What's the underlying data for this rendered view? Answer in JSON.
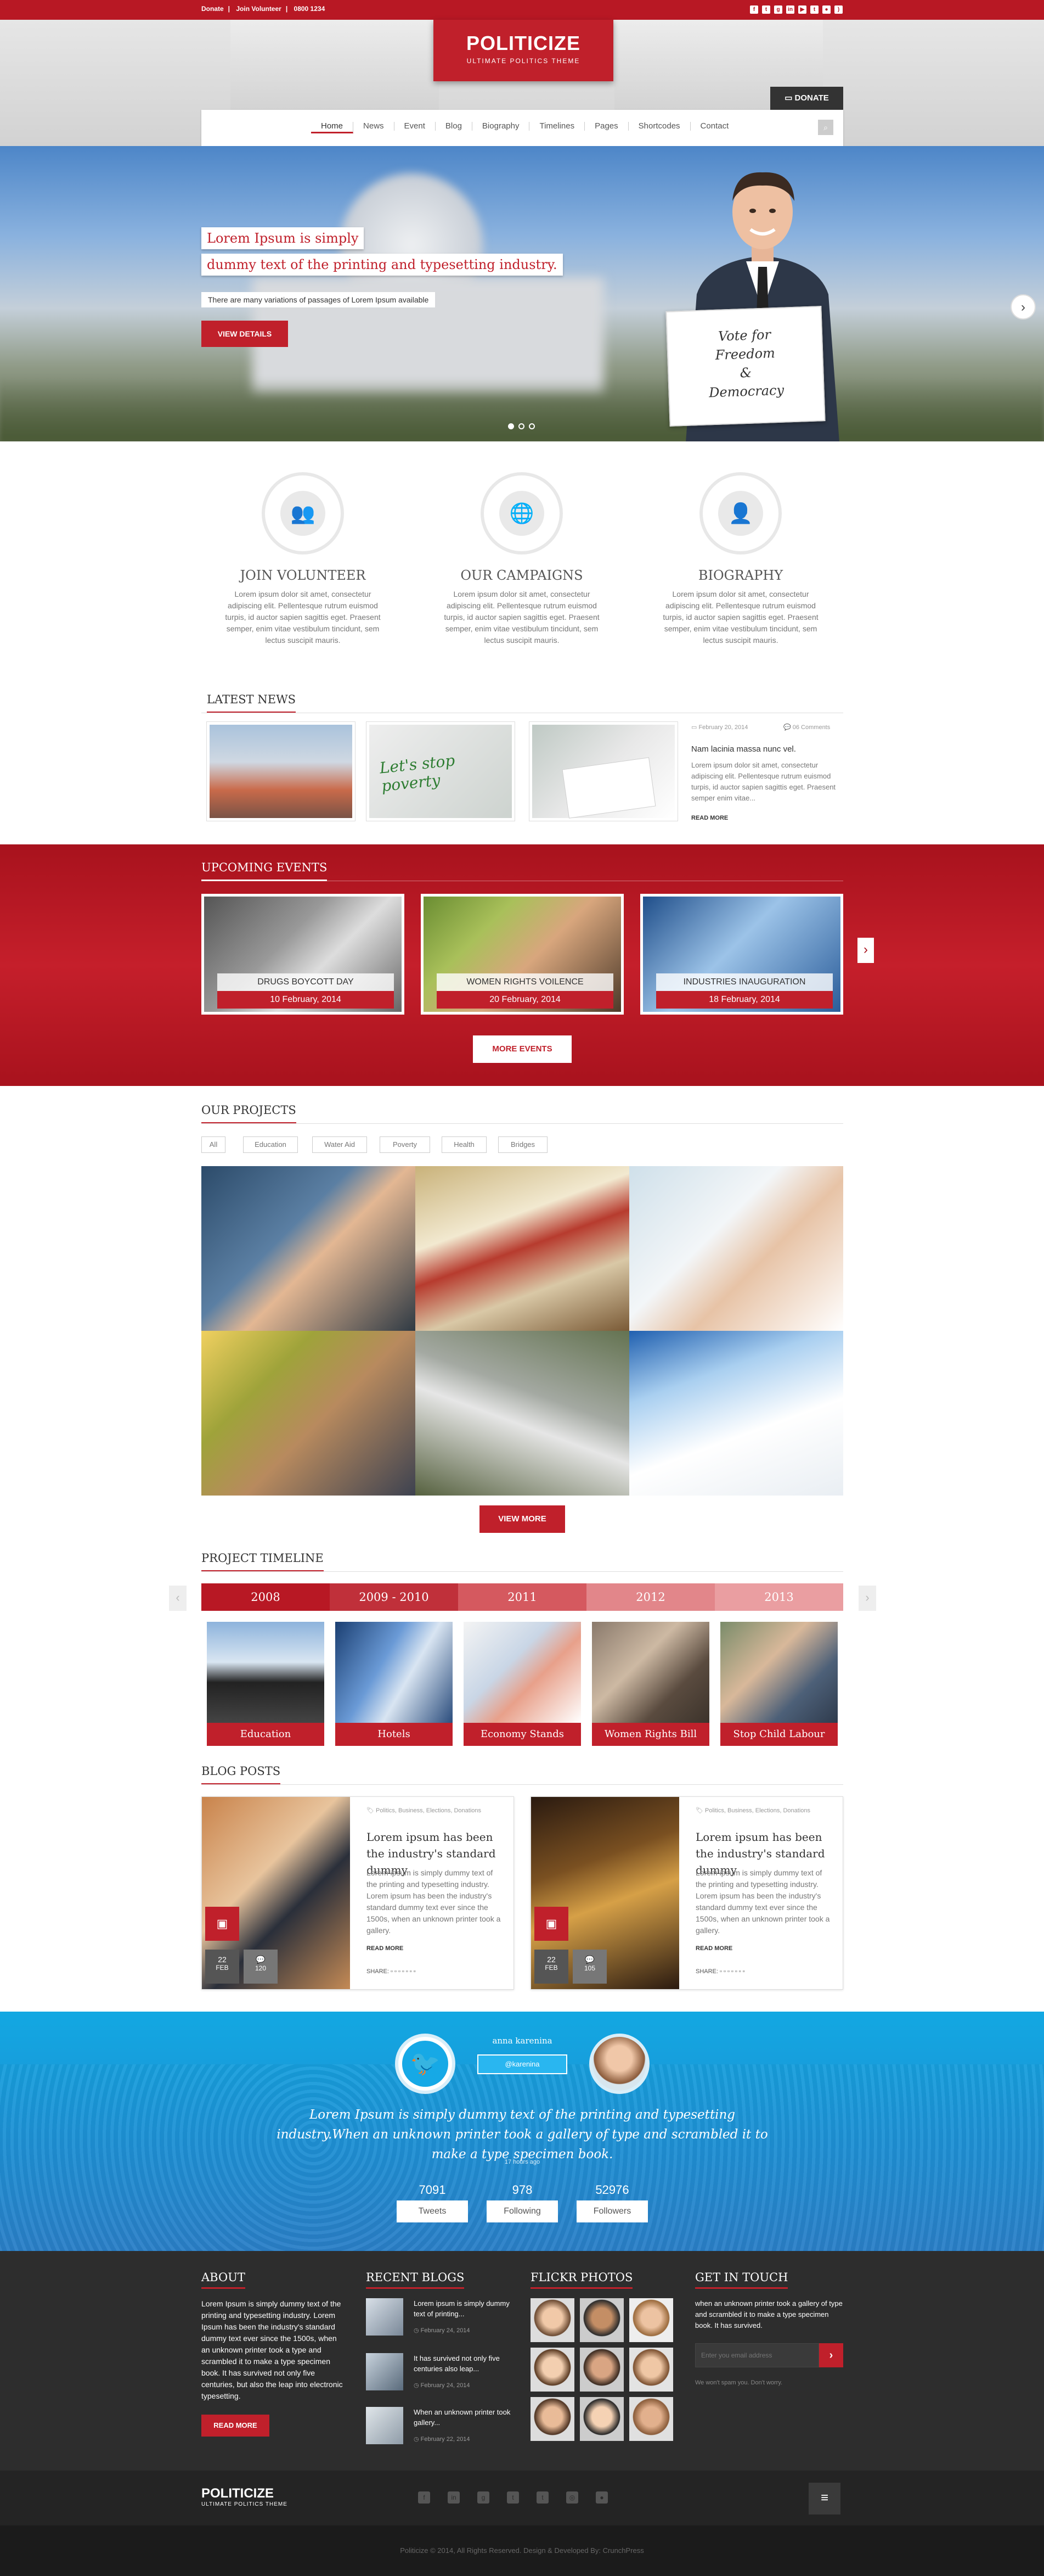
{
  "topbar": {
    "donate": "Donate",
    "volunteer": "Join Volunteer",
    "phone": "0800 1234",
    "social_icons": [
      "facebook-icon",
      "twitter-icon",
      "google-plus-icon",
      "linkedin-icon",
      "youtube-icon",
      "tumblr-icon",
      "flickr-icon",
      "rss-icon"
    ]
  },
  "logo": {
    "title": "POLITICIZE",
    "subtitle": "ULTIMATE POLITICS THEME"
  },
  "donate_button": "DONATE",
  "nav": [
    "Home",
    "News",
    "Event",
    "Blog",
    "Biography",
    "Timelines",
    "Pages",
    "Shortcodes",
    "Contact"
  ],
  "hero": {
    "headline1": "Lorem Ipsum is simply",
    "headline2": "dummy text of the printing and typesetting industry.",
    "sub": "There are many variations of passages of Lorem Ipsum available",
    "button": "VIEW DETAILS",
    "sign": [
      "Vote for",
      "Freedom",
      "&",
      "Democracy"
    ]
  },
  "features": [
    {
      "title": "JOIN VOLUNTEER",
      "text": "Lorem ipsum dolor sit amet, consectetur adipiscing elit. Pellentesque rutrum euismod turpis, id auctor sapien sagittis eget. Praesent semper, enim vitae vestibulum tincidunt, sem lectus suscipit mauris."
    },
    {
      "title": "OUR CAMPAIGNS",
      "text": "Lorem ipsum dolor sit amet, consectetur adipiscing elit. Pellentesque rutrum euismod turpis, id auctor sapien sagittis eget. Praesent semper, enim vitae vestibulum tincidunt, sem lectus suscipit mauris."
    },
    {
      "title": "BIOGRAPHY",
      "text": "Lorem ipsum dolor sit amet, consectetur adipiscing elit. Pellentesque rutrum euismod turpis, id auctor sapien sagittis eget. Praesent semper, enim vitae vestibulum tincidunt, sem lectus suscipit mauris."
    }
  ],
  "news": {
    "heading": "LATEST NEWS",
    "date": "February 20, 2014",
    "comments": "06 Comments",
    "title": "Nam lacinia massa nunc vel.",
    "text": "Lorem ipsum dolor sit amet, consectetur adipiscing elit. Pellentesque rutrum euismod turpis, id auctor sapien sagittis eget. Praesent semper enim vitae...",
    "readmore": "READ MORE",
    "img2_text": "Let's stop poverty"
  },
  "events": {
    "heading": "UPCOMING EVENTS",
    "items": [
      {
        "title": "DRUGS BOYCOTT DAY",
        "date": "10 February, 2014"
      },
      {
        "title": "WOMEN RIGHTS VOILENCE",
        "date": "20 February, 2014"
      },
      {
        "title": "INDUSTRIES INAUGURATION",
        "date": "18 February, 2014"
      }
    ],
    "button": "MORE EVENTS"
  },
  "projects": {
    "heading": "OUR PROJECTS",
    "filters": [
      "All",
      "Education",
      "Water Aid",
      "Poverty",
      "Health",
      "Bridges"
    ],
    "button": "VIEW MORE"
  },
  "timeline": {
    "heading": "PROJECT TIMELINE",
    "years": [
      "2008",
      "2009 - 2010",
      "2011",
      "2012",
      "2013"
    ],
    "cards": [
      "Education",
      "Hotels",
      "Economy Stands",
      "Women Rights Bill",
      "Stop Child Labour"
    ]
  },
  "blog": {
    "heading": "BLOG POSTS",
    "posts": [
      {
        "meta": "Politics, Business, Elections, Donations",
        "title": "Lorem ipsum has been the industry's standard dummy",
        "text": "Lorem ipsum is simply dummy text of the printing and typesetting industry. Lorem ipsum has been the industry's standard dummy text ever since the 1500s, when an unknown printer took a gallery.",
        "readmore": "READ MORE",
        "share": "SHARE:",
        "day": "22",
        "month": "FEB",
        "count": "120"
      },
      {
        "meta": "Politics, Business, Elections, Donations",
        "title": "Lorem ipsum has been the industry's standard dummy",
        "text": "Lorem ipsum is simply dummy text of the printing and typesetting industry. Lorem ipsum has been the industry's standard dummy text ever since the 1500s, when an unknown printer took a gallery.",
        "readmore": "READ MORE",
        "share": "SHARE:",
        "day": "22",
        "month": "FEB",
        "count": "105"
      }
    ]
  },
  "twitter": {
    "name": "anna karenina",
    "handle": "@karenina",
    "tweet": "Lorem Ipsum is simply dummy text of the printing and typesetting industry.When an unknown printer took a gallery of type and scrambled it to make a type specimen book.",
    "time": "17 hours ago",
    "stats": [
      {
        "value": "7091",
        "label": "Tweets"
      },
      {
        "value": "978",
        "label": "Following"
      },
      {
        "value": "52976",
        "label": "Followers"
      }
    ]
  },
  "footer": {
    "about_h": "ABOUT",
    "about": "Lorem Ipsum is simply dummy text of the printing and typesetting industry. Lorem Ipsum has been the industry's standard dummy text ever since the 1500s, when an unknown printer took a type and scrambled it to make a type specimen book. It has survived not only five centuries, but also the leap into electronic typesetting.",
    "read_more": "READ MORE",
    "blogs_h": "RECENT BLOGS",
    "blogs": [
      {
        "title": "Lorem ipsum is simply dummy text of printing...",
        "date": "February 24, 2014"
      },
      {
        "title": "It has survived not only five centuries also leap...",
        "date": "February 24, 2014"
      },
      {
        "title": "When an unknown printer took gallery...",
        "date": "February 22, 2014"
      }
    ],
    "flickr_h": "FLICKR PHOTOS",
    "touch_h": "GET IN TOUCH",
    "touch": "when an unknown printer took a gallery of type and scrambled it to make a type specimen book. It has survived.",
    "email_placeholder": "Enter you email address",
    "spam": "We won't spam you. Don't worry.",
    "logo": "POLITICIZE",
    "logo_sub": "ULTIMATE POLITICS THEME",
    "copyright": "Politicize © 2014, All Rights Reserved. Design & Developed By: CrunchPress"
  }
}
